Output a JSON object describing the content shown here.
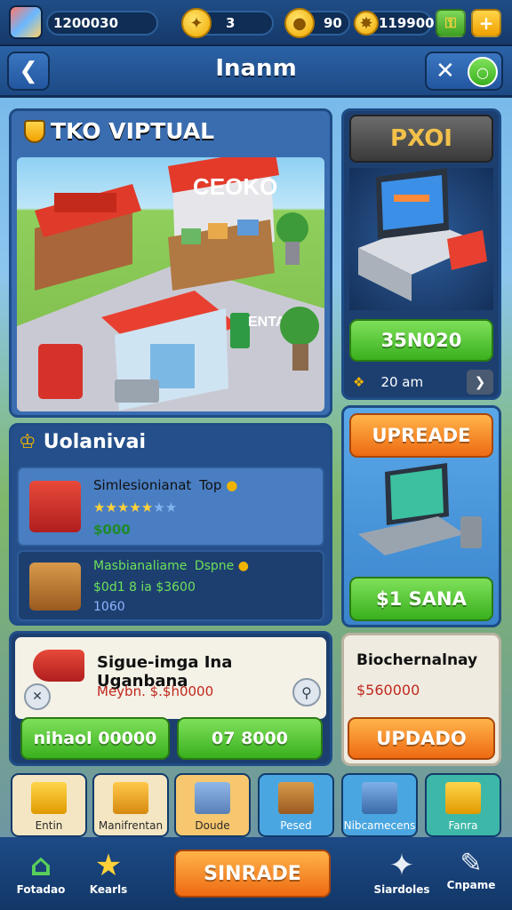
{
  "topbar": {
    "gems": "1200030",
    "coins_a": "3",
    "coins_b": "90",
    "cash": "119900"
  },
  "header": {
    "title": "Inanm",
    "close_label": "✕"
  },
  "shop": {
    "title": "TKO VIPTUAL",
    "sign_main": "CEOKO",
    "entrance_label": "ENTADA"
  },
  "pc_panel": {
    "title": "PXOI",
    "price": "35N020",
    "meta_text": "20 am"
  },
  "upgrades": {
    "title": "Uolanivai",
    "items": [
      {
        "name": "Simlesionianat",
        "tag": "Top",
        "stars": 5,
        "price": "$000"
      },
      {
        "name": "Masbianaliame",
        "tag": "Dspne",
        "detail": "$0d1 8 ia $3600",
        "price": "1060"
      }
    ]
  },
  "laptop_panel": {
    "top_button": "UPREADE",
    "bottom_button": "$1 SANA"
  },
  "promo": {
    "title": "Sigue-imga Ina Uganbana",
    "subtitle": "Meybn. $.$h0000",
    "btn_left": "nihaol 00000",
    "btn_right": "07 8000"
  },
  "promo2": {
    "title": "Biochernalnay",
    "price": "$560000",
    "button": "UPDADO"
  },
  "categories": [
    {
      "label": "Entin",
      "color": "#f4e6c2"
    },
    {
      "label": "Manifrentan",
      "color": "#f4e6c2"
    },
    {
      "label": "Doude",
      "color": "#f6c76e"
    },
    {
      "label": "Pesed",
      "color": "#4aa6e0"
    },
    {
      "label": "Nibcamecens",
      "color": "#4aa6e0"
    },
    {
      "label": "Fanra",
      "color": "#3db8a8"
    }
  ],
  "nav": {
    "left1": "Fotadao",
    "left2": "Kearls",
    "center": "SINRADE",
    "right1": "Siardoles",
    "right2": "Cnpame"
  },
  "colors": {
    "green": "#39b01e",
    "orange": "#ee6a12",
    "panel": "#244f8a"
  }
}
